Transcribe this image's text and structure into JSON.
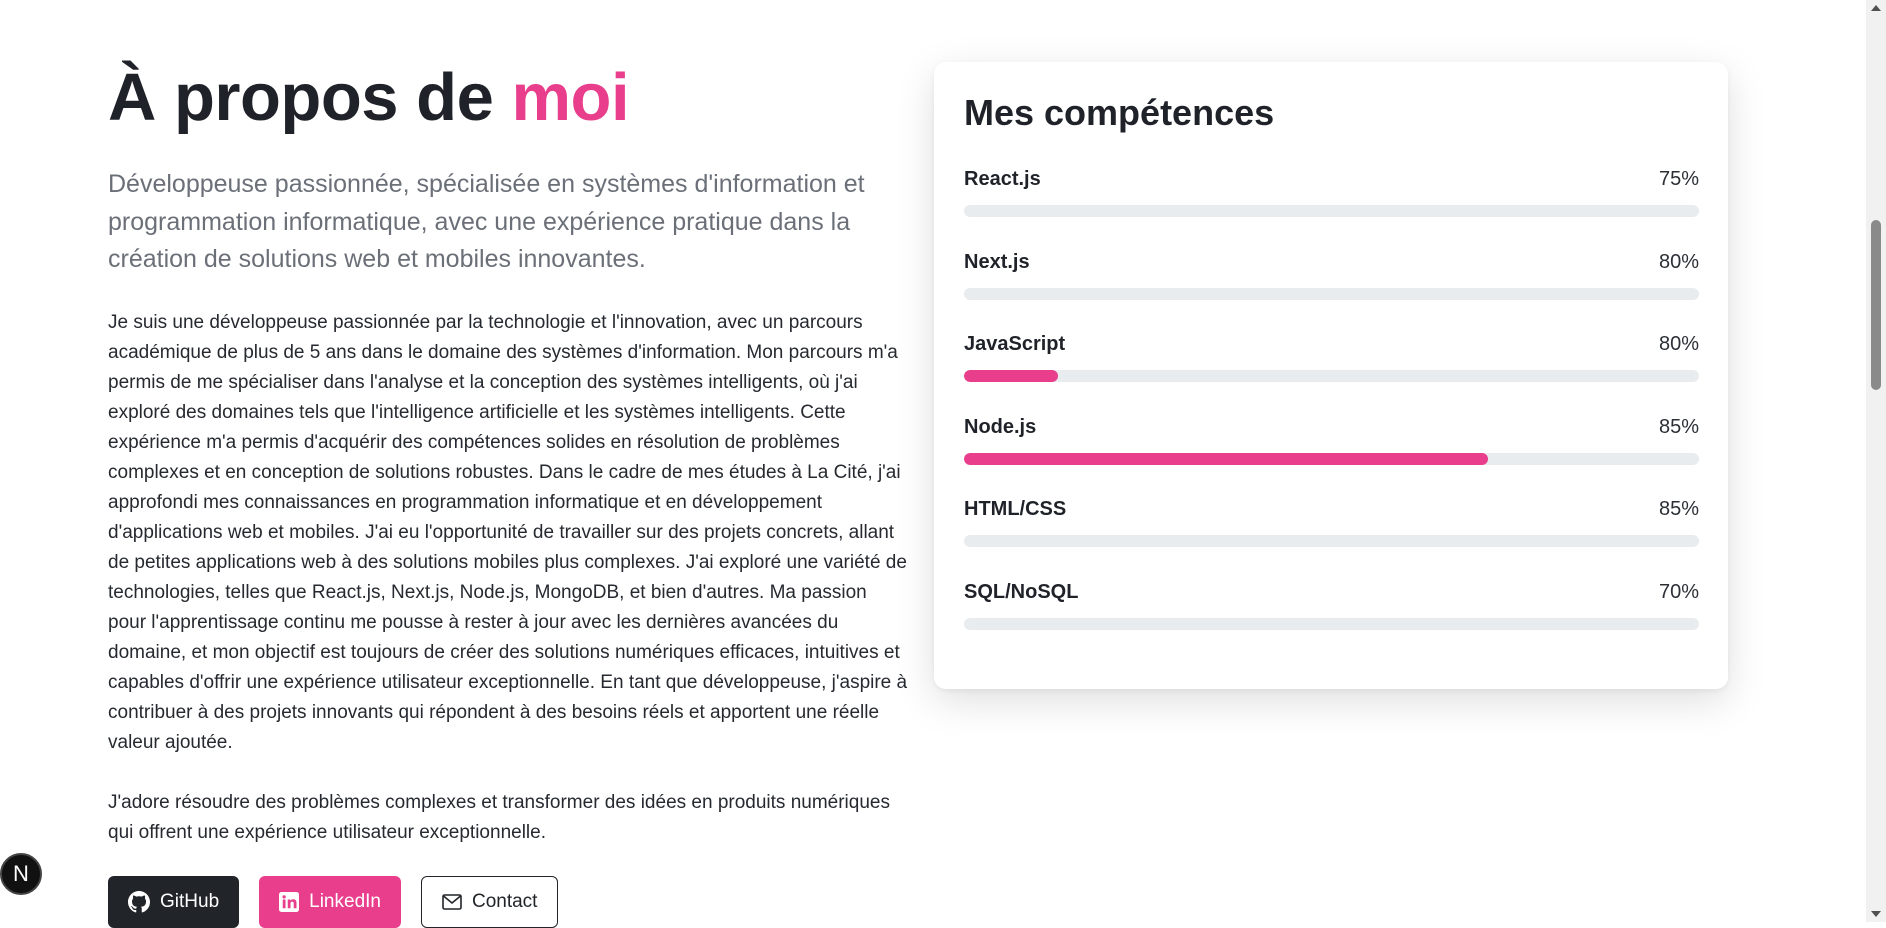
{
  "about": {
    "title_prefix": "À propos de",
    "title_accent": "moi",
    "intro": "Développeuse passionnée, spécialisée en systèmes d'information et programmation informatique, avec une expérience pratique dans la création de solutions web et mobiles innovantes.",
    "paragraph1": "Je suis une développeuse passionnée par la technologie et l'innovation, avec un parcours académique de plus de 5 ans dans le domaine des systèmes d'information. Mon parcours m'a permis de me spécialiser dans l'analyse et la conception des systèmes intelligents, où j'ai exploré des domaines tels que l'intelligence artificielle et les systèmes intelligents. Cette expérience m'a permis d'acquérir des compétences solides en résolution de problèmes complexes et en conception de solutions robustes. Dans le cadre de mes études à La Cité, j'ai approfondi mes connaissances en programmation informatique et en développement d'applications web et mobiles. J'ai eu l'opportunité de travailler sur des projets concrets, allant de petites applications web à des solutions mobiles plus complexes. J'ai exploré une variété de technologies, telles que React.js, Next.js, Node.js, MongoDB, et bien d'autres. Ma passion pour l'apprentissage continu me pousse à rester à jour avec les dernières avancées du domaine, et mon objectif est toujours de créer des solutions numériques efficaces, intuitives et capables d'offrir une expérience utilisateur exceptionnelle. En tant que développeuse, j'aspire à contribuer à des projets innovants qui répondent à des besoins réels et apportent une réelle valeur ajoutée.",
    "paragraph2": "J'adore résoudre des problèmes complexes et transformer des idées en produits numériques qui offrent une expérience utilisateur exceptionnelle.",
    "buttons": {
      "github": "GitHub",
      "linkedin": "LinkedIn",
      "contact": "Contact"
    }
  },
  "skills": {
    "title": "Mes compétences",
    "items": [
      {
        "name": "React.js",
        "percent_label": "75%",
        "fill": 0
      },
      {
        "name": "Next.js",
        "percent_label": "80%",
        "fill": 0
      },
      {
        "name": "JavaScript",
        "percent_label": "80%",
        "fill": 0.128
      },
      {
        "name": "Node.js",
        "percent_label": "85%",
        "fill": 0.713
      },
      {
        "name": "HTML/CSS",
        "percent_label": "85%",
        "fill": 0
      },
      {
        "name": "SQL/NoSQL",
        "percent_label": "70%",
        "fill": 0
      }
    ]
  },
  "badge": {
    "letter": "N"
  },
  "icons": {
    "github": "github-icon",
    "linkedin": "linkedin-icon",
    "contact": "mail-icon"
  },
  "colors": {
    "accent": "#e83e8c",
    "dark": "#212529",
    "track": "#e9ecef"
  }
}
